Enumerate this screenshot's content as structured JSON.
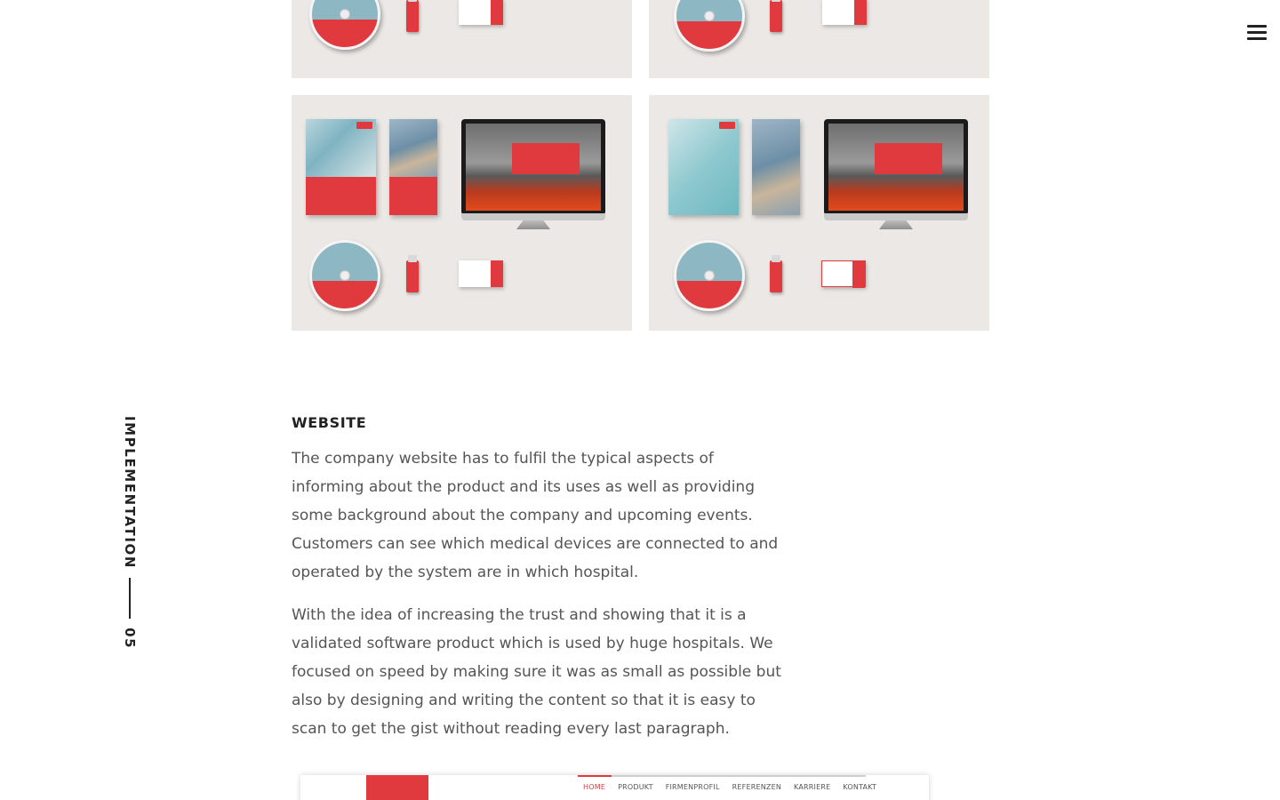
{
  "header": {
    "menu_icon": "hamburger-menu-icon"
  },
  "section": {
    "label": "IMPLEMENTATION",
    "number": "05"
  },
  "gallery": {
    "tiles": [
      "brand-mockup-1",
      "brand-mockup-2",
      "brand-mockup-3",
      "brand-mockup-4"
    ]
  },
  "content": {
    "heading": "WEBSITE",
    "paragraph_1": "The company website has to fulfil the typical aspects of informing about the product and its uses as well as providing some background about the company and upcoming events. Customers can see which medical devices are connected to and operated by the system are in which hospital.",
    "paragraph_2": "With the idea of increasing the trust and showing that it is a validated software product which is used by huge hospitals. We focused on speed by making sure it was as small as possible but also by designing and writing the content so that it is easy to scan to get the gist without reading every last paragraph."
  },
  "website_preview": {
    "nav": [
      "HOME",
      "PRODUKT",
      "FIRMENPROFIL",
      "REFERENZEN",
      "KARRIERE",
      "KONTAKT"
    ]
  },
  "colors": {
    "accent": "#e0393e",
    "tile_bg": "#ebe8e5",
    "text": "#555555",
    "heading": "#222222"
  }
}
